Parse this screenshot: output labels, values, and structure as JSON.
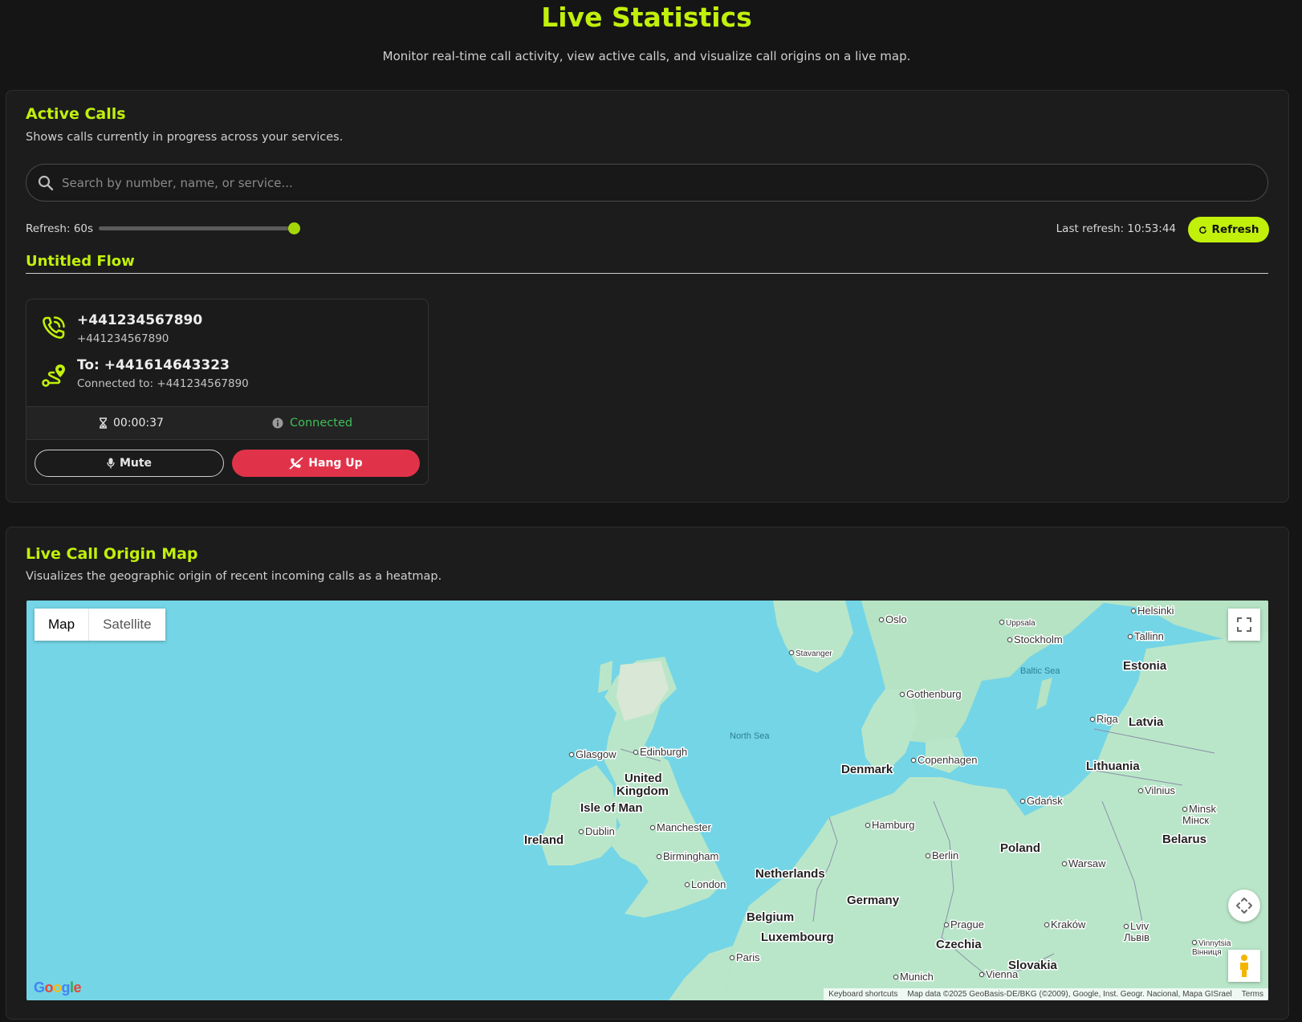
{
  "header": {
    "title": "Live Statistics",
    "subtitle": "Monitor real-time call activity, view active calls, and visualize call origins on a live map."
  },
  "active_calls": {
    "title": "Active Calls",
    "description": "Shows calls currently in progress across your services.",
    "search": {
      "placeholder": "Search by number, name, or service...",
      "value": ""
    },
    "refresh": {
      "label": "Refresh: 60s",
      "slider_level": 1.0,
      "last_refresh": "Last refresh: 10:53:44",
      "button_label": "Refresh"
    },
    "flow": {
      "title": "Untitled Flow",
      "call": {
        "caller_number": "+441234567890",
        "caller_sub": "+441234567890",
        "to_number": "To: +441614643323",
        "connected_to": "Connected to: +441234567890",
        "duration": "00:00:37",
        "status": "Connected",
        "mute_label": "Mute",
        "hangup_label": "Hang Up"
      }
    }
  },
  "map_section": {
    "title": "Live Call Origin Map",
    "description": "Visualizes the geographic origin of recent incoming calls as a heatmap.",
    "map_type": {
      "options": [
        "Map",
        "Satellite"
      ],
      "selected": "Map"
    },
    "labels": {
      "countries": [
        "United",
        "Kingdom",
        "Isle of Man",
        "Ireland",
        "Denmark",
        "Netherlands",
        "Belgium",
        "Luxembourg",
        "Germany",
        "Poland",
        "Czechia",
        "Slovakia",
        "Lithuania",
        "Latvia",
        "Estonia",
        "Belarus"
      ],
      "cities": [
        "Oslo",
        "Uppsala",
        "Helsinki",
        "Stavanger",
        "Stockholm",
        "Tallinn",
        "Gothenburg",
        "Riga",
        "Edinburgh",
        "Glasgow",
        "Copenhagen",
        "Vilnius",
        "Minsk",
        "Мінск",
        "Dublin",
        "Manchester",
        "Hamburg",
        "Gdańsk",
        "Birmingham",
        "Berlin",
        "Warsaw",
        "London",
        "Prague",
        "Kraków",
        "Lviv",
        "Львів",
        "Vinnytsia",
        "Вінниця",
        "Paris",
        "Munich",
        "Vienna"
      ],
      "seas": [
        "North Sea",
        "Baltic Sea"
      ]
    },
    "google_logo": "Google",
    "attribution": {
      "shortcuts": "Keyboard shortcuts",
      "data": "Map data ©2025 GeoBasis-DE/BKG (©2009), Google, Inst. Geogr. Nacional, Mapa GISrael",
      "terms": "Terms"
    }
  },
  "colors": {
    "accent": "#c1f00b",
    "background": "#151515",
    "panel": "#1c1c1c",
    "danger": "#e0334a",
    "success": "#3fbf5a",
    "sea": "#74d5e6",
    "land": "#b9e6c9"
  }
}
